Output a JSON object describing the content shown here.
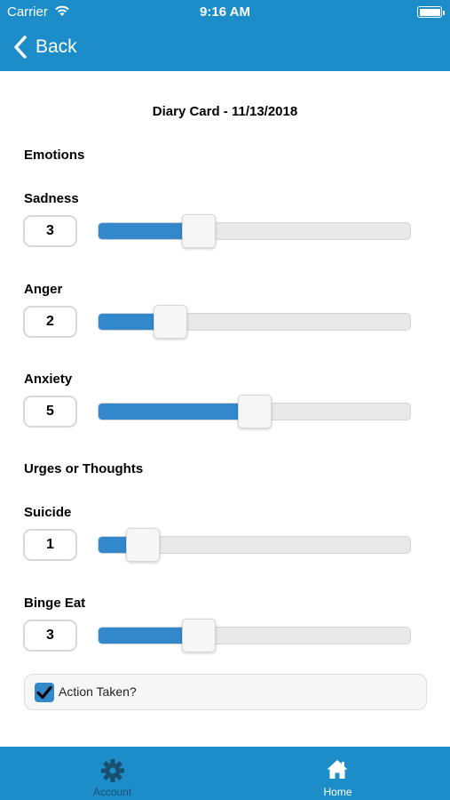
{
  "status_bar": {
    "carrier": "Carrier",
    "time": "9:16 AM"
  },
  "nav": {
    "back_label": "Back"
  },
  "page": {
    "title": "Diary Card - 11/13/2018"
  },
  "sections": {
    "emotions": "Emotions",
    "urges": "Urges or Thoughts"
  },
  "ratings": {
    "min": 0,
    "max": 10,
    "sadness": {
      "label": "Sadness",
      "value": 3
    },
    "anger": {
      "label": "Anger",
      "value": 2
    },
    "anxiety": {
      "label": "Anxiety",
      "value": 5
    },
    "suicide": {
      "label": "Suicide",
      "value": 1
    },
    "binge_eat": {
      "label": "Binge Eat",
      "value": 3
    }
  },
  "action_taken": {
    "label": "Action Taken?",
    "checked": true
  },
  "tabs": [
    {
      "label": "Account",
      "icon": "gear-icon"
    },
    {
      "label": "Home",
      "icon": "home-icon",
      "active": true
    }
  ],
  "colors": {
    "header": "#1c8dc8",
    "slider_fill": "#3388cc",
    "track": "#e9e9e9",
    "active_tab_label": "#ffffff",
    "inactive_tab_label": "#1b4e6c"
  }
}
